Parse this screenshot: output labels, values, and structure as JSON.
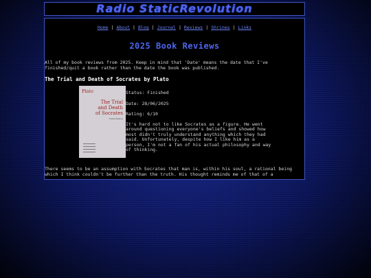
{
  "site": {
    "title": "Radio StaticRevolution"
  },
  "nav": {
    "items": [
      "Home",
      "About",
      "Blog",
      "Journal",
      "Reviews",
      "Shrines",
      "Links"
    ]
  },
  "page": {
    "heading": "2025 Book Reviews",
    "intro": "All of my book reviews from 2025. Keep in mind that 'Date' means the date that I've finished/quit a book rather than the date the book was published."
  },
  "review": {
    "heading": "The Trial and Death of Socrates by Plato",
    "cover": {
      "author": "Plato",
      "title_line1": "The Trial",
      "title_line2": "and Death",
      "title_line3": "of Socrates",
      "subtitle": "Third Edition"
    },
    "status": "Status: Finished",
    "date": "Date: 28/06/2025",
    "rating": "Rating: 6/10",
    "text": "It's hard not to like Socrates as a figure. He went around questioning everyone's beliefs and showed how most didn't truly understand anything which they had said. Unfortunately, despite how I like him as a person, I'm not a fan of his actual philosophy and way of thinking.",
    "continued": "There seems to be an assumption with Socrates that man is, within his soul, a rational being which I think couldn't be further than the truth. His thought reminds me of that of a"
  }
}
